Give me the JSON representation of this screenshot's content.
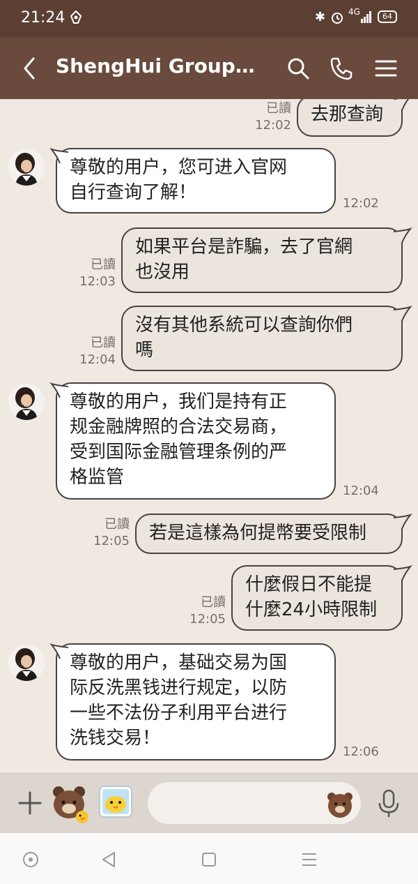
{
  "status_bar": {
    "time": "21:24",
    "network": "4G",
    "battery": "64"
  },
  "header": {
    "title": "ShengHui GroupTt..."
  },
  "messages": [
    {
      "side": "out",
      "text": "去那查詢",
      "read": "已讀",
      "time": "12:02"
    },
    {
      "side": "in",
      "text": "尊敬的用户，您可进入官网\n自行查询了解！",
      "time": "12:02"
    },
    {
      "side": "out",
      "text": "如果平台是詐騙，去了官網\n也沒用",
      "read": "已讀",
      "time": "12:03"
    },
    {
      "side": "out",
      "text": "沒有其他系統可以查詢你們\n嗎",
      "read": "已讀",
      "time": "12:04"
    },
    {
      "side": "in",
      "text": "尊敬的用户，我们是持有正\n规金融牌照的合法交易商，\n受到国际金融管理条例的严\n格监管",
      "time": "12:04"
    },
    {
      "side": "out",
      "text": "若是這樣為何提幣要受限制",
      "read": "已讀",
      "time": "12:05"
    },
    {
      "side": "out",
      "text": "什麼假日不能提\n什麼24小時限制",
      "read": "已讀",
      "time": "12:05"
    },
    {
      "side": "in",
      "text": "尊敬的用户，基础交易为国\n际反洗黑钱进行规定，以防\n一些不法份子利用平台进行\n洗钱交易！",
      "time": "12:06"
    }
  ],
  "input": {
    "placeholder": ""
  },
  "colors": {
    "header": "#6a4a3c",
    "status_bar": "#5b3f33",
    "chat_bg": "#efe9e2",
    "bubble_in": "#ffffff",
    "bubble_out": "#ebe5de"
  }
}
